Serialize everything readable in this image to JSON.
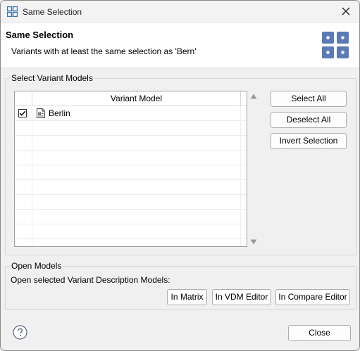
{
  "window": {
    "title": "Same Selection",
    "close_icon": "close-icon"
  },
  "banner": {
    "title": "Same Selection",
    "message": "Variants with at least the same selection as 'Bern'",
    "icon": "variant-grid-icon",
    "icon_color": "#5a7bb5"
  },
  "select_group": {
    "label": "Select Variant Models",
    "table": {
      "column_header": "Variant Model",
      "rows": [
        {
          "label": "Berlin",
          "checked": true
        }
      ],
      "empty_rows": 9
    },
    "buttons": {
      "select_all": "Select All",
      "deselect_all": "Deselect All",
      "invert_selection": "Invert Selection"
    }
  },
  "open_group": {
    "label": "Open Models",
    "description": "Open selected Variant Description Models:",
    "buttons": {
      "in_matrix": "In Matrix",
      "in_vdm_editor": "In VDM Editor",
      "in_compare_editor": "In Compare Editor"
    }
  },
  "footer": {
    "help_icon": "help-icon",
    "close_label": "Close"
  }
}
